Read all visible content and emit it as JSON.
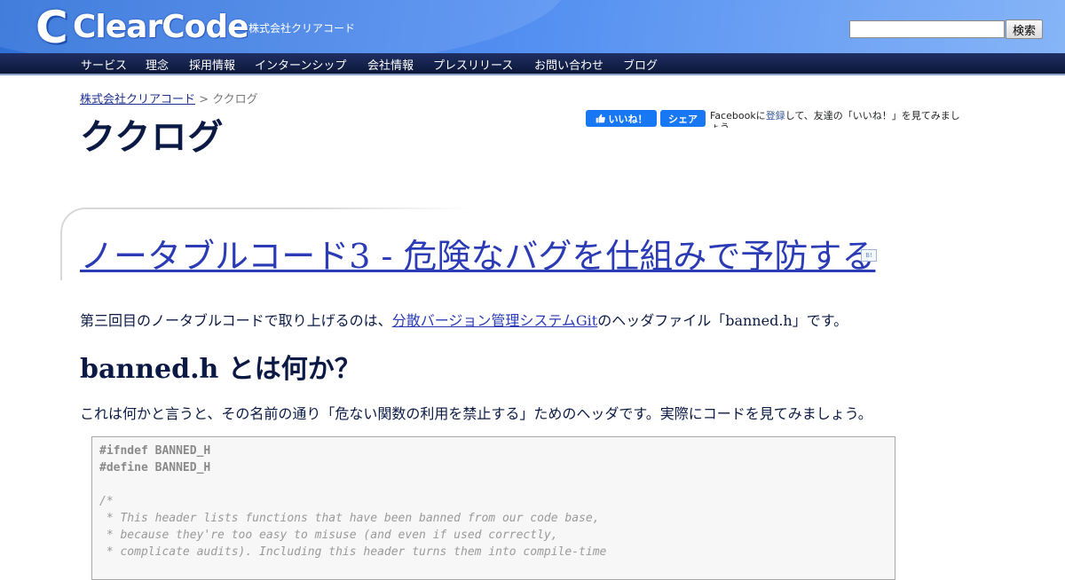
{
  "header": {
    "logo_text": "ClearCode",
    "logo_mark": "C",
    "company_name": "株式会社クリアコード",
    "search": {
      "value": "",
      "button_label": "検索"
    }
  },
  "nav": {
    "items": [
      {
        "label": "サービス"
      },
      {
        "label": "理念"
      },
      {
        "label": "採用情報"
      },
      {
        "label": "インターンシップ"
      },
      {
        "label": "会社情報"
      },
      {
        "label": "プレスリリース"
      },
      {
        "label": "お問い合わせ"
      },
      {
        "label": "ブログ"
      }
    ]
  },
  "breadcrumb": {
    "home": "株式会社クリアコード",
    "separator": " > ",
    "current": "ククログ"
  },
  "page_title": "ククログ",
  "facebook": {
    "like_label": "いいね！",
    "share_label": "シェア",
    "text_prefix": "Facebookに",
    "text_link": "登録",
    "text_suffix": "して、友達の「いいね！」を見てみましょう。"
  },
  "article": {
    "title": "ノータブルコード3 - 危険なバグを仕組みで予防する",
    "hatena_icon_label": "B!",
    "intro_prefix": "第三回目のノータブルコードで取り上げるのは、",
    "intro_link": "分散バージョン管理システムGit",
    "intro_suffix": "のヘッダファイル「banned.h」です。",
    "section_heading": "banned.h とは何か？",
    "paragraph": "これは何かと言うと、その名前の通り「危ない関数の利用を禁止する」ためのヘッダです。実際にコードを見てみましょう。",
    "code_lines": [
      "#ifndef BANNED_H",
      "#define BANNED_H",
      "",
      "/*",
      " * This header lists functions that have been banned from our code base,",
      " * because they're too easy to misuse (and even if used correctly,",
      " * complicate audits). Including this header turns them into compile-time"
    ]
  },
  "colors": {
    "header_blue": "#4f8cf0",
    "nav_navy": "#0c1738",
    "link": "#2a3bb5",
    "text": "#0b1a44",
    "facebook_blue": "#1877f2"
  }
}
